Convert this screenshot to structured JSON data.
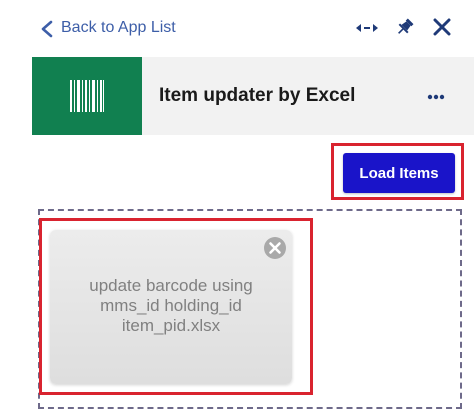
{
  "topbar": {
    "back_label": "Back to App List",
    "icons": [
      "chevron-left-icon",
      "resize-arrows-icon",
      "pin-icon",
      "close-icon"
    ]
  },
  "app": {
    "title": "Item updater by Excel",
    "logo_icon": "barcode-icon",
    "logo_bg_color": "#118050",
    "menu_icon": "more-horizontal-icon"
  },
  "actions": {
    "load_label": "Load Items",
    "load_color": "#1a14c9"
  },
  "file": {
    "name_lines": [
      "update barcode using",
      "mms_id holding_id",
      "item_pid.xlsx"
    ],
    "remove_icon": "remove-circle-icon"
  },
  "colors": {
    "accent_link": "#3d5ea8",
    "highlight": "#d9232f"
  }
}
